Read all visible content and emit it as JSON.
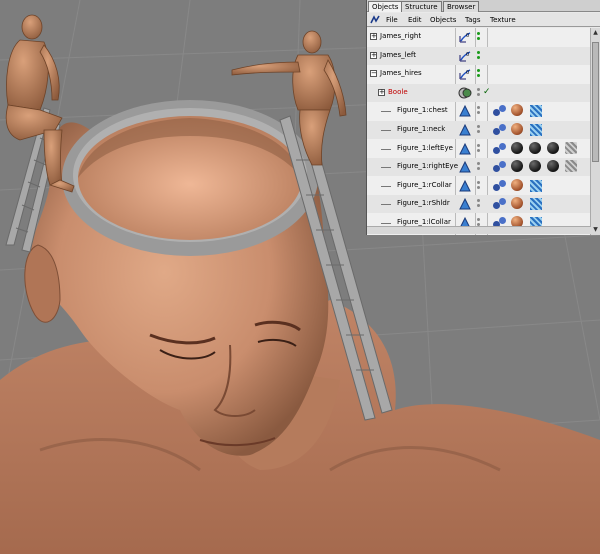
{
  "panel": {
    "tabs": [
      {
        "label": "Objects",
        "active": true
      },
      {
        "label": "Structure",
        "active": false
      },
      {
        "label": "Browser",
        "active": false
      }
    ],
    "menu": [
      "File",
      "Edit",
      "Objects",
      "Tags",
      "Texture"
    ],
    "rows": [
      {
        "expander": "+",
        "label": "James_right",
        "label_color": "#000000",
        "type_icon": "bone-icon",
        "dot_colors": [
          "#1a9a1a",
          "#1a9a1a"
        ],
        "tags": []
      },
      {
        "expander": "+",
        "label": "James_left",
        "label_color": "#000000",
        "type_icon": "bone-icon",
        "dot_colors": [
          "#1a9a1a",
          "#1a9a1a"
        ],
        "tags": []
      },
      {
        "expander": "−",
        "label": "James_hires",
        "label_color": "#000000",
        "type_icon": "bone-icon",
        "dot_colors": [
          "#1a9a1a",
          "#1a9a1a"
        ],
        "tags": []
      },
      {
        "expander": "+",
        "label": "Boole",
        "label_color": "#c00000",
        "type_icon": "boole-icon",
        "dot_colors": [
          "#888888",
          "#888888"
        ],
        "check": "✓",
        "tags": []
      },
      {
        "expander": "",
        "label": "Figure_1:chest",
        "label_color": "#000000",
        "type_icon": "polygon-icon",
        "dot_colors": [
          "#888888",
          "#888888"
        ],
        "tags": [
          "phong-icon",
          "material-orange",
          "uvw-icon"
        ]
      },
      {
        "expander": "",
        "label": "Figure_1:neck",
        "label_color": "#000000",
        "type_icon": "polygon-icon",
        "dot_colors": [
          "#888888",
          "#888888"
        ],
        "tags": [
          "phong-icon",
          "material-orange",
          "uvw-icon"
        ]
      },
      {
        "expander": "",
        "label": "Figure_1:leftEye",
        "label_color": "#000000",
        "type_icon": "polygon-icon",
        "dot_colors": [
          "#888888",
          "#888888"
        ],
        "tags": [
          "phong-icon",
          "material-dark",
          "material-dark",
          "material-dark",
          "material-striped"
        ]
      },
      {
        "expander": "",
        "label": "Figure_1:rightEye",
        "label_color": "#000000",
        "type_icon": "polygon-icon",
        "dot_colors": [
          "#888888",
          "#888888"
        ],
        "tags": [
          "phong-icon",
          "material-dark",
          "material-dark",
          "material-dark",
          "material-striped"
        ]
      },
      {
        "expander": "",
        "label": "Figure_1:rCollar",
        "label_color": "#000000",
        "type_icon": "polygon-icon",
        "dot_colors": [
          "#888888",
          "#888888"
        ],
        "tags": [
          "phong-icon",
          "material-orange",
          "uvw-icon"
        ]
      },
      {
        "expander": "",
        "label": "Figure_1:rShldr",
        "label_color": "#000000",
        "type_icon": "polygon-icon",
        "dot_colors": [
          "#888888",
          "#888888"
        ],
        "tags": [
          "phong-icon",
          "material-orange",
          "uvw-icon"
        ]
      },
      {
        "expander": "",
        "label": "Figure_1:lCollar",
        "label_color": "#000000",
        "type_icon": "polygon-icon",
        "dot_colors": [
          "#888888",
          "#888888"
        ],
        "tags": [
          "phong-icon",
          "material-orange",
          "uvw-icon"
        ]
      }
    ]
  },
  "colors": {
    "accent_arrow": "#b80000",
    "skin": "#c98d6d",
    "viewport_bg": "#7d7d7d"
  }
}
